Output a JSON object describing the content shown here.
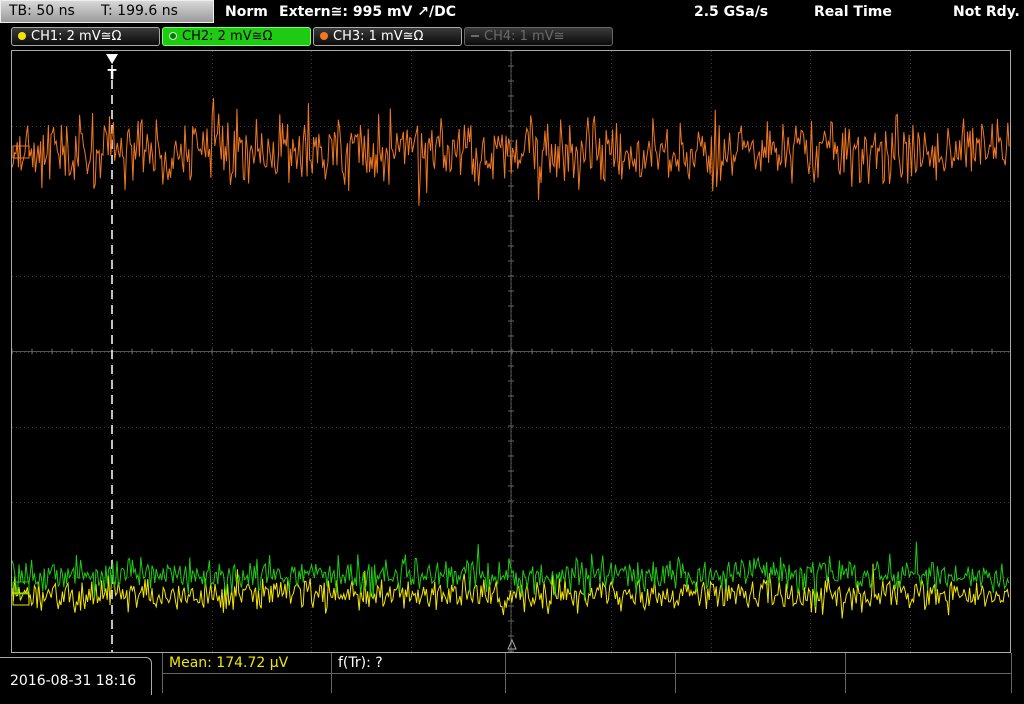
{
  "topbar": {
    "timebase": "TB: 50 ns",
    "trigger_time": "T: 199.6 ns",
    "mode": "Norm",
    "trigger_source": "Extern≅: 995 mV ↗/DC",
    "sample_rate": "2.5 GSa/s",
    "acquisition": "Real Time",
    "status": "Not Rdy."
  },
  "channels": [
    {
      "label": "CH1: 2 mV≅Ω",
      "color": "#f2e600",
      "state": "on"
    },
    {
      "label": "CH2: 2 mV≅Ω",
      "color": "#1ecb12",
      "state": "selected"
    },
    {
      "label": "CH3: 1 mV≅Ω",
      "color": "#f07820",
      "state": "on"
    },
    {
      "label": "CH4: 1 mV≅",
      "color": "#6a6a6a",
      "state": "off"
    }
  ],
  "markers": {
    "trigger_marker": "T"
  },
  "traces": {
    "ch3_color": "#f07820",
    "ch2_color": "#1ecb12",
    "ch1_color": "#f2e600"
  },
  "measurements": {
    "mean": "Mean: 174.72 µV",
    "freq": "f(Tr): ?"
  },
  "datetime": "2016-08-31 18:16"
}
